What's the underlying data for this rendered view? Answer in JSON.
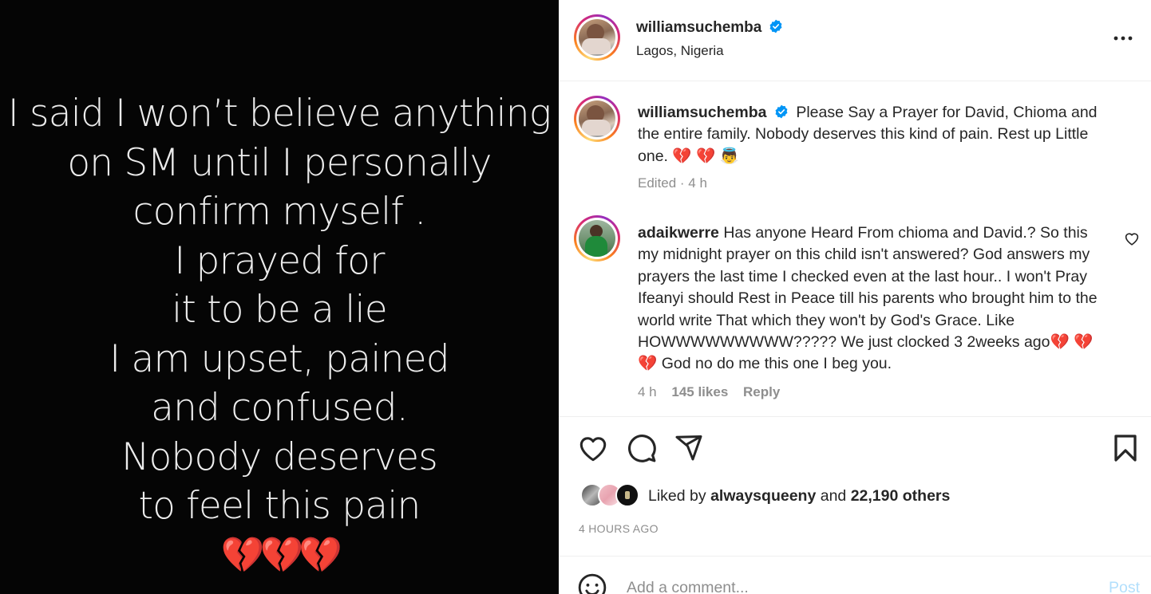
{
  "media": {
    "lines": [
      "I said I won’t believe anything",
      "on SM until I personally",
      "confirm myself .",
      "I prayed for",
      "it to be a lie",
      "I am upset, pained",
      "and confused.",
      "Nobody deserves",
      "to feel this pain"
    ],
    "emoji": "💔💔💔"
  },
  "header": {
    "username": "williamsuchemba",
    "location": "Lagos, Nigeria"
  },
  "caption": {
    "username": "williamsuchemba",
    "text": "Please Say a Prayer for David, Chioma and the entire family. Nobody deserves this kind of pain. Rest up Little one. 💔 💔  👼",
    "meta": "Edited · 4 h"
  },
  "comment": {
    "username": "adaikwerre",
    "text": "Has anyone Heard From chioma and David.? So this my midnight prayer on this child isn't answered? God answers my prayers the last time I checked even at the last hour.. I won't Pray Ifeanyi should Rest in Peace till his parents who brought him to the world write That which they won't by God's Grace. Like HOWWWWWWWWW????? We just clocked 3 2weeks ago💔 💔 💔  God no do me this one I beg you.",
    "time": "4 h",
    "likes": "145 likes",
    "reply": "Reply"
  },
  "likes": {
    "prefix": "Liked by",
    "user": "alwaysqueeny",
    "middle": "and",
    "others": "22,190 others"
  },
  "timestamp": "4 HOURS AGO",
  "composer": {
    "placeholder": "Add a comment...",
    "post_label": "Post"
  },
  "icons": {
    "verified": "verified-badge-icon",
    "more": "more-options-icon",
    "like": "heart-icon",
    "comment": "comment-bubble-icon",
    "share": "share-paper-plane-icon",
    "save": "bookmark-icon",
    "emoji": "emoji-smiley-icon"
  },
  "colors": {
    "verified": "#0095f6",
    "muted": "#8e8e8e",
    "post_disabled": "#b2dffc"
  }
}
